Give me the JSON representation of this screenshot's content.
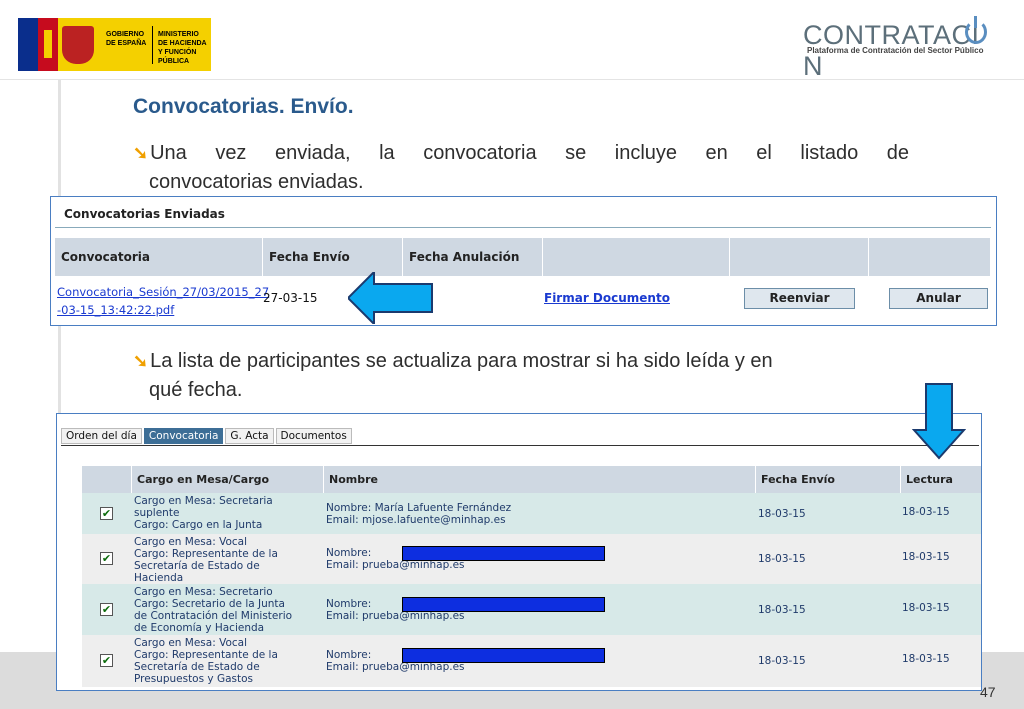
{
  "header": {
    "gov_logo_text": "GOBIERNO\nDE ESPAÑA",
    "ministry_text": "MINISTERIO\nDE HACIENDA\nY FUNCIÓN PÚBLICA",
    "platform_title": "CONTRATACI",
    "platform_title_end": "N",
    "platform_subtitle": "Plataforma de Contratación del Sector Público"
  },
  "slide": {
    "title": "Convocatorias. Envío.",
    "bullet1_line1": [
      "Una",
      "vez",
      "enviada,",
      "la",
      "convocatoria",
      "se",
      "incluye",
      "en",
      "el",
      "listado",
      "de"
    ],
    "bullet1_line2": "convocatorias  enviadas.",
    "bullet2_line1": "La lista de participantes se actualiza para mostrar si ha sido leída y en",
    "bullet2_line2": "qué fecha.",
    "page_number": "47"
  },
  "sent_panel": {
    "title": "Convocatorias Enviadas",
    "columns": [
      "Convocatoria",
      "Fecha Envío",
      "Fecha Anulación",
      "",
      "",
      ""
    ],
    "row": {
      "link_line1": "Convocatoria_Sesión_27/03/2015_27",
      "link_line2": "-03-15_13:42:22.pdf",
      "date": "27-03-15",
      "sign_link": "Firmar Documento",
      "resend_button": "Reenviar",
      "cancel_button": "Anular"
    }
  },
  "participants_panel": {
    "tabs": [
      "Orden del día",
      "Convocatoria",
      "G. Acta",
      "Documentos"
    ],
    "active_tab": "Convocatoria",
    "columns": [
      "Cargo en Mesa/Cargo",
      "Nombre",
      "Fecha Envío",
      "Lectura"
    ],
    "rows": [
      {
        "cargo": "Cargo en Mesa: Secretaria\nsuplente\nCargo: Cargo en la Junta",
        "nombre": "Nombre: María Lafuente Fernández\nEmail: mjose.lafuente@minhap.es",
        "fecha_envio": "18-03-15",
        "lectura": "18-03-15"
      },
      {
        "cargo": "Cargo en Mesa: Vocal\nCargo: Representante de la\nSecretaría de Estado de\nHacienda",
        "nombre": "Nombre:\nEmail: prueba@minhap.es",
        "fecha_envio": "18-03-15",
        "lectura": "18-03-15"
      },
      {
        "cargo": "Cargo en Mesa: Secretario\nCargo: Secretario de la Junta\nde Contratación del Ministerio\nde Economía y Hacienda",
        "nombre": "Nombre:\nEmail: prueba@minhap.es",
        "fecha_envio": "18-03-15",
        "lectura": "18-03-15"
      },
      {
        "cargo": "Cargo en Mesa: Vocal\nCargo: Representante de la\nSecretaría de Estado de\nPresupuestos y Gastos",
        "nombre": "Nombre:\nEmail: prueba@minhap.es",
        "fecha_envio": "18-03-15",
        "lectura": "18-03-15"
      }
    ]
  }
}
